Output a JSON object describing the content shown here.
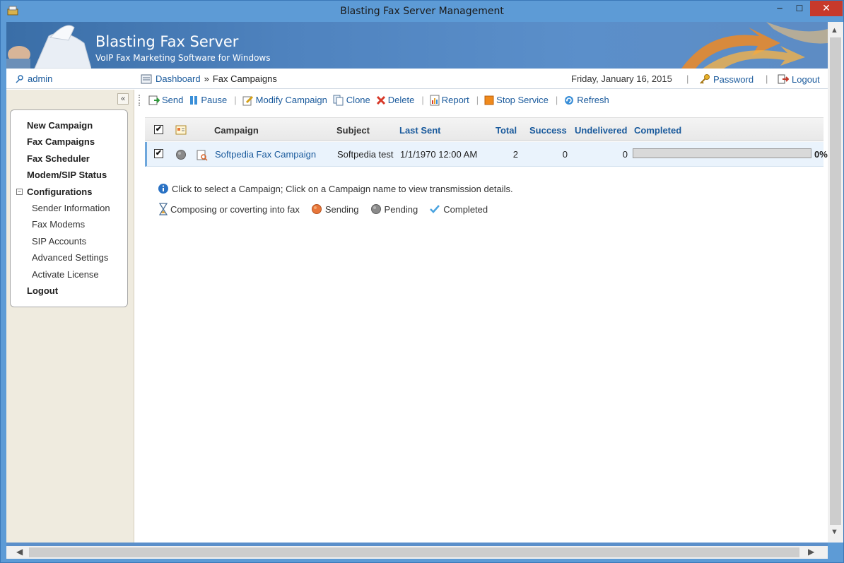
{
  "window": {
    "title": "Blasting Fax Server Management",
    "minimize": "─",
    "maximize": "☐",
    "close": "✕"
  },
  "banner": {
    "title": "Blasting Fax Server",
    "subtitle": "VoIP Fax Marketing Software for Windows"
  },
  "header": {
    "user": "admin",
    "breadcrumb_home": "Dashboard",
    "breadcrumb_sep": "»",
    "breadcrumb_current": "Fax Campaigns",
    "date": "Friday, January 16, 2015",
    "separator": "|",
    "password": "Password",
    "logout": "Logout"
  },
  "sidebar": {
    "collapse": "«",
    "items": {
      "new_campaign": "New Campaign",
      "fax_campaigns": "Fax Campaigns",
      "fax_scheduler": "Fax Scheduler",
      "modem_sip_status": "Modem/SIP Status",
      "configurations": "Configurations",
      "sender_information": "Sender Information",
      "fax_modems": "Fax Modems",
      "sip_accounts": "SIP Accounts",
      "advanced_settings": "Advanced Settings",
      "activate_license": "Activate License",
      "logout": "Logout"
    },
    "expand_symbol": "−"
  },
  "toolbar": {
    "send": "Send",
    "pause": "Pause",
    "modify": "Modify Campaign",
    "clone": "Clone",
    "delete": "Delete",
    "report": "Report",
    "stop_service": "Stop Service",
    "refresh": "Refresh",
    "separator": "|"
  },
  "table": {
    "columns": {
      "campaign": "Campaign",
      "subject": "Subject",
      "last_sent": "Last Sent",
      "total": "Total",
      "success": "Success",
      "undelivered": "Undelivered",
      "completed": "Completed"
    },
    "rows": [
      {
        "checked": "✔",
        "campaign": "Softpedia Fax Campaign",
        "subject": "Softpedia test",
        "last_sent": "1/1/1970 12:00 AM",
        "total": "2",
        "success": "0",
        "undelivered": "0",
        "completed_pct": "0%",
        "completed_fraction": 0
      }
    ],
    "header_check": "✔"
  },
  "info": {
    "hint": "Click to select a Campaign; Click on a Campaign name to view transmission details.",
    "legend_composing": "Composing or coverting into fax",
    "legend_sending": "Sending",
    "legend_pending": "Pending",
    "legend_completed": "Completed"
  },
  "colors": {
    "accent": "#1a5a9c",
    "sending": "#e8763a",
    "pending": "#8a8a8a",
    "completed": "#4aa3df"
  }
}
